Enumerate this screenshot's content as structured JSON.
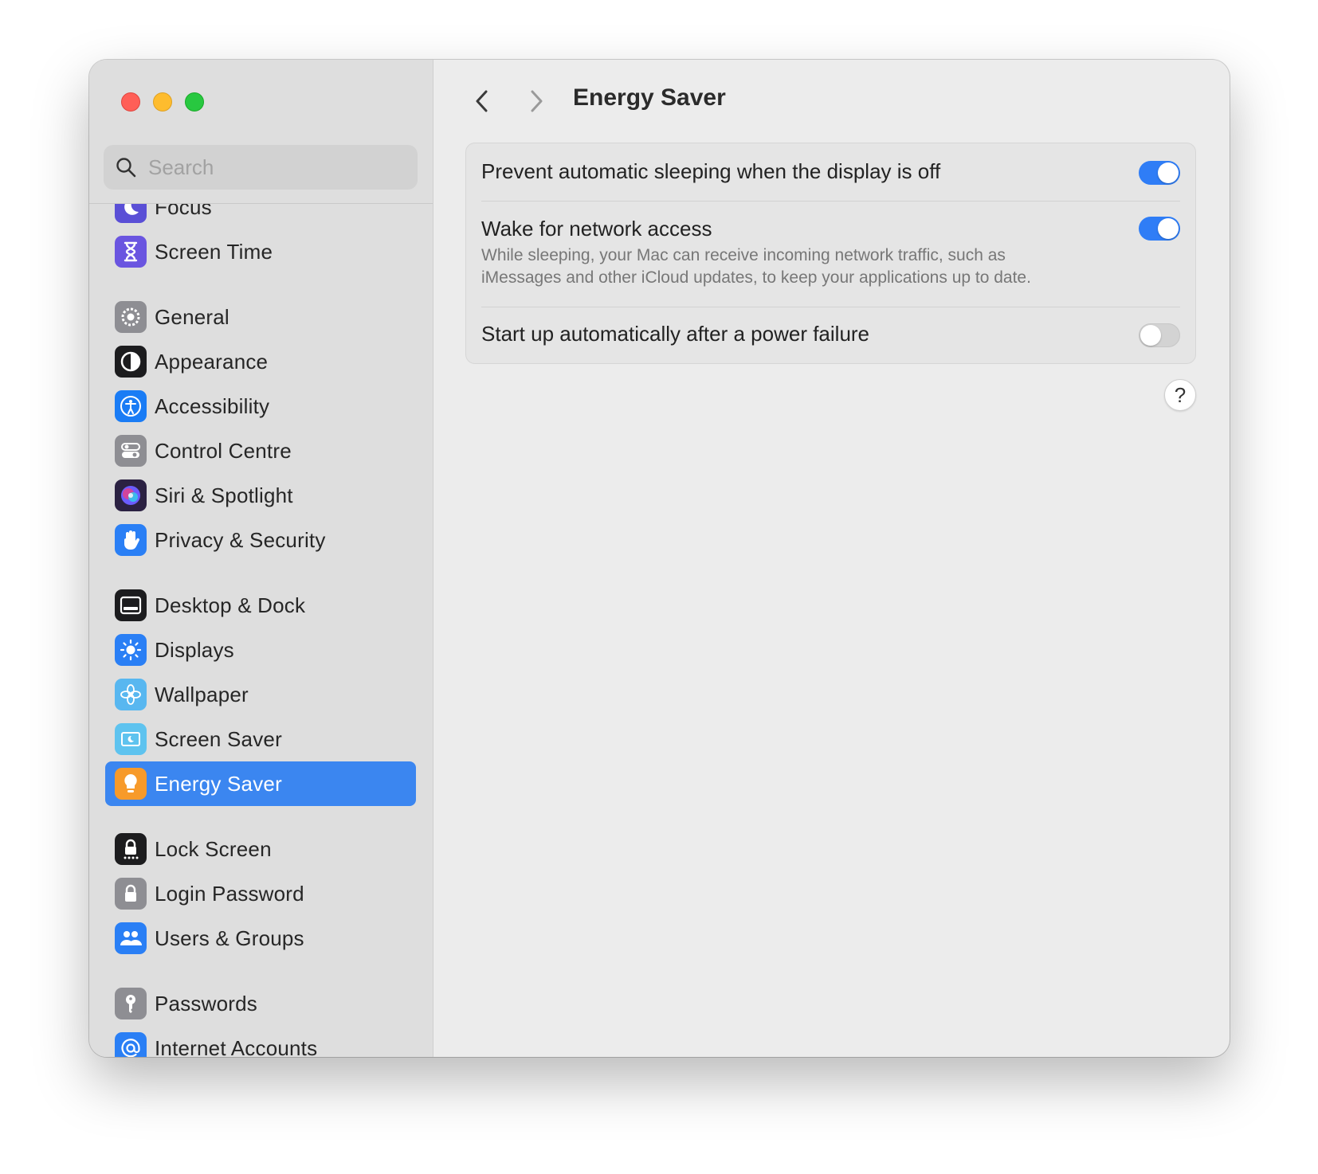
{
  "window": {
    "title": "Energy Saver"
  },
  "search": {
    "placeholder": "Search"
  },
  "sidebar": {
    "items": [
      {
        "label": "Focus",
        "icon": "moon-icon",
        "color": "#5a4fd6"
      },
      {
        "label": "Screen Time",
        "icon": "hourglass-icon",
        "color": "#6a55e0"
      },
      {
        "label": "General",
        "icon": "gear-icon",
        "color": "#8e8e93"
      },
      {
        "label": "Appearance",
        "icon": "appearance-icon",
        "color": "#1c1c1e"
      },
      {
        "label": "Accessibility",
        "icon": "accessibility-icon",
        "color": "#1a7cf5"
      },
      {
        "label": "Control Centre",
        "icon": "control-centre-icon",
        "color": "#8e8e93"
      },
      {
        "label": "Siri & Spotlight",
        "icon": "siri-icon",
        "color": "#2b2142"
      },
      {
        "label": "Privacy & Security",
        "icon": "hand-icon",
        "color": "#2a7ff5"
      },
      {
        "label": "Desktop & Dock",
        "icon": "dock-icon",
        "color": "#1c1c1e"
      },
      {
        "label": "Displays",
        "icon": "sun-icon",
        "color": "#2a7ff5"
      },
      {
        "label": "Wallpaper",
        "icon": "flower-icon",
        "color": "#58b7f0"
      },
      {
        "label": "Screen Saver",
        "icon": "screen-saver-icon",
        "color": "#5ec3ef"
      },
      {
        "label": "Energy Saver",
        "icon": "lightbulb-icon",
        "color": "#f79a2a",
        "selected": true
      },
      {
        "label": "Lock Screen",
        "icon": "lock-screen-icon",
        "color": "#1c1c1e"
      },
      {
        "label": "Login Password",
        "icon": "lock-icon",
        "color": "#8e8e93"
      },
      {
        "label": "Users & Groups",
        "icon": "users-icon",
        "color": "#2a7ff5"
      },
      {
        "label": "Passwords",
        "icon": "key-icon",
        "color": "#8e8e93"
      },
      {
        "label": "Internet Accounts",
        "icon": "at-icon",
        "color": "#2a7ff5"
      }
    ]
  },
  "settings": {
    "rows": [
      {
        "label": "Prevent automatic sleeping when the display is off",
        "enabled": true
      },
      {
        "label": "Wake for network access",
        "description": "While sleeping, your Mac can receive incoming network traffic, such as iMessages and other iCloud updates, to keep your applications up to date.",
        "enabled": true
      },
      {
        "label": "Start up automatically after a power failure",
        "enabled": false
      }
    ]
  },
  "help": {
    "label": "?"
  },
  "colors": {
    "accent": "#2f7df6",
    "selection": "#3b86f0"
  }
}
